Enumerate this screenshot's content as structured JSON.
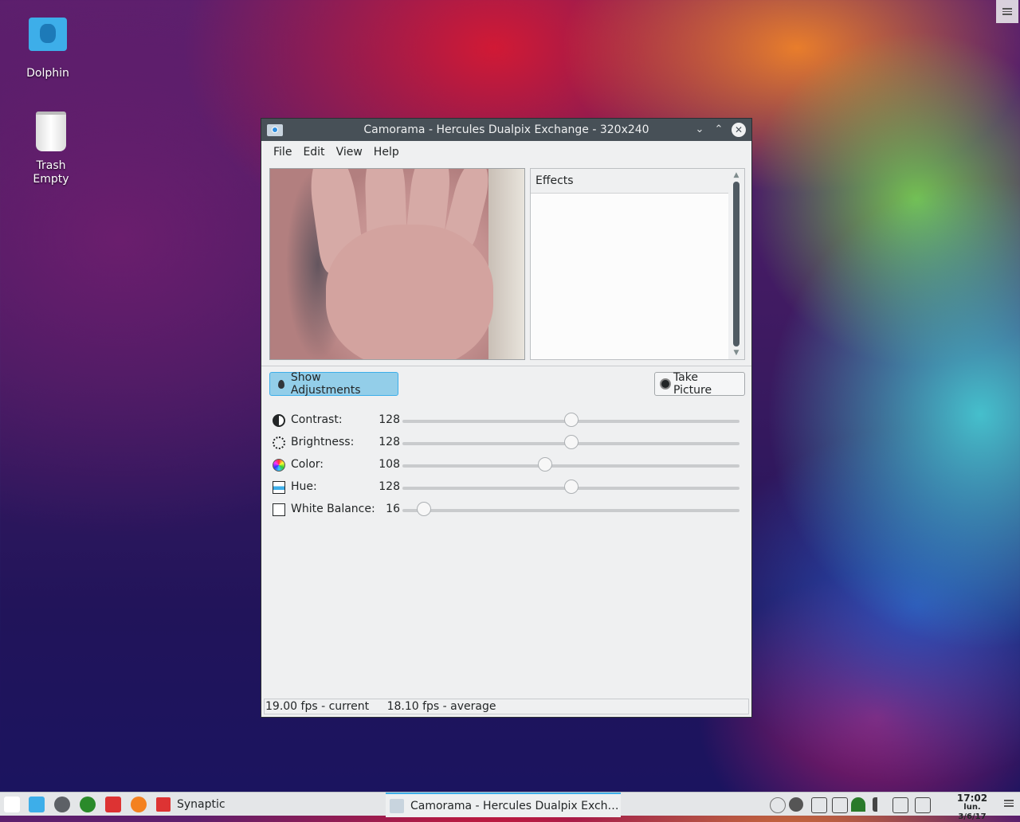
{
  "desktop": {
    "icons": [
      {
        "label": "Dolphin",
        "icon": "dolphin-folder-icon"
      },
      {
        "label": "Trash",
        "sublabel": "Empty",
        "icon": "trash-icon"
      }
    ]
  },
  "window": {
    "title": "Camorama - Hercules Dualpix Exchange - 320x240",
    "controls": {
      "minimize": "⌄",
      "maximize": "⌃",
      "close": "✕"
    },
    "menu": [
      "File",
      "Edit",
      "View",
      "Help"
    ],
    "effects_header": "Effects",
    "show_adjustments": "Show Adjustments",
    "take_picture": "Take Picture",
    "adjustments": [
      {
        "label": "Contrast:",
        "value": "128",
        "fraction": 0.5,
        "icon": "contrast-icon"
      },
      {
        "label": "Brightness:",
        "value": "128",
        "fraction": 0.5,
        "icon": "brightness-icon"
      },
      {
        "label": "Color:",
        "value": "108",
        "fraction": 0.424,
        "icon": "color-wheel-icon"
      },
      {
        "label": "Hue:",
        "value": "128",
        "fraction": 0.5,
        "icon": "hue-icon"
      },
      {
        "label": "White Balance:",
        "value": "16",
        "fraction": 0.063,
        "icon": "white-balance-icon"
      }
    ],
    "status": {
      "current": "19.00 fps - current",
      "average": "18.10 fps - average"
    }
  },
  "taskbar": {
    "launchers": [
      "application-launcher-icon",
      "dolphin-icon",
      "system-settings-icon",
      "xbox-icon",
      "download-icon",
      "firefox-icon"
    ],
    "tasks": [
      {
        "label": "Synaptic",
        "active": false
      },
      {
        "label": "Camorama - Hercules Dualpix Exch…",
        "active": true
      }
    ],
    "clock": {
      "time": "17:02",
      "date": "lun. 3/6/17"
    }
  },
  "colors": {
    "accent": "#3daee9",
    "titlebar": "#475057",
    "window_bg": "#eff0f1"
  }
}
